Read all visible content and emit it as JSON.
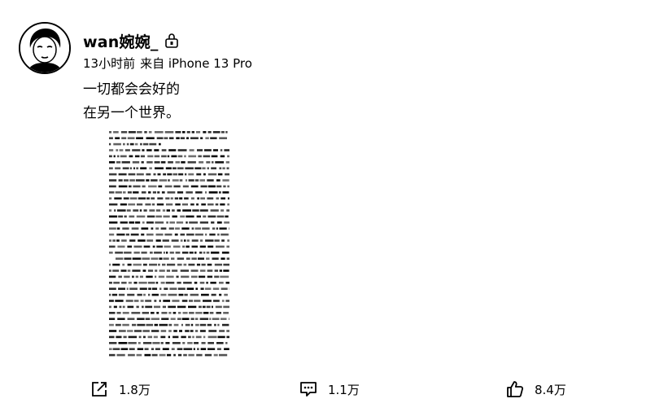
{
  "post": {
    "author": "wan婉婉_",
    "time": "13小时前",
    "source": "来自 iPhone 13 Pro",
    "lines": [
      "一切都会会好的",
      "在另一个世界。"
    ]
  },
  "actions": {
    "repost_count": "1.8万",
    "comment_count": "1.1万",
    "like_count": "8.4万"
  },
  "icons": {
    "avatar": "portrait-avatar",
    "badge": "member-badge-icon",
    "repost": "share-icon",
    "comment": "comment-icon",
    "like": "thumbs-up-icon"
  }
}
